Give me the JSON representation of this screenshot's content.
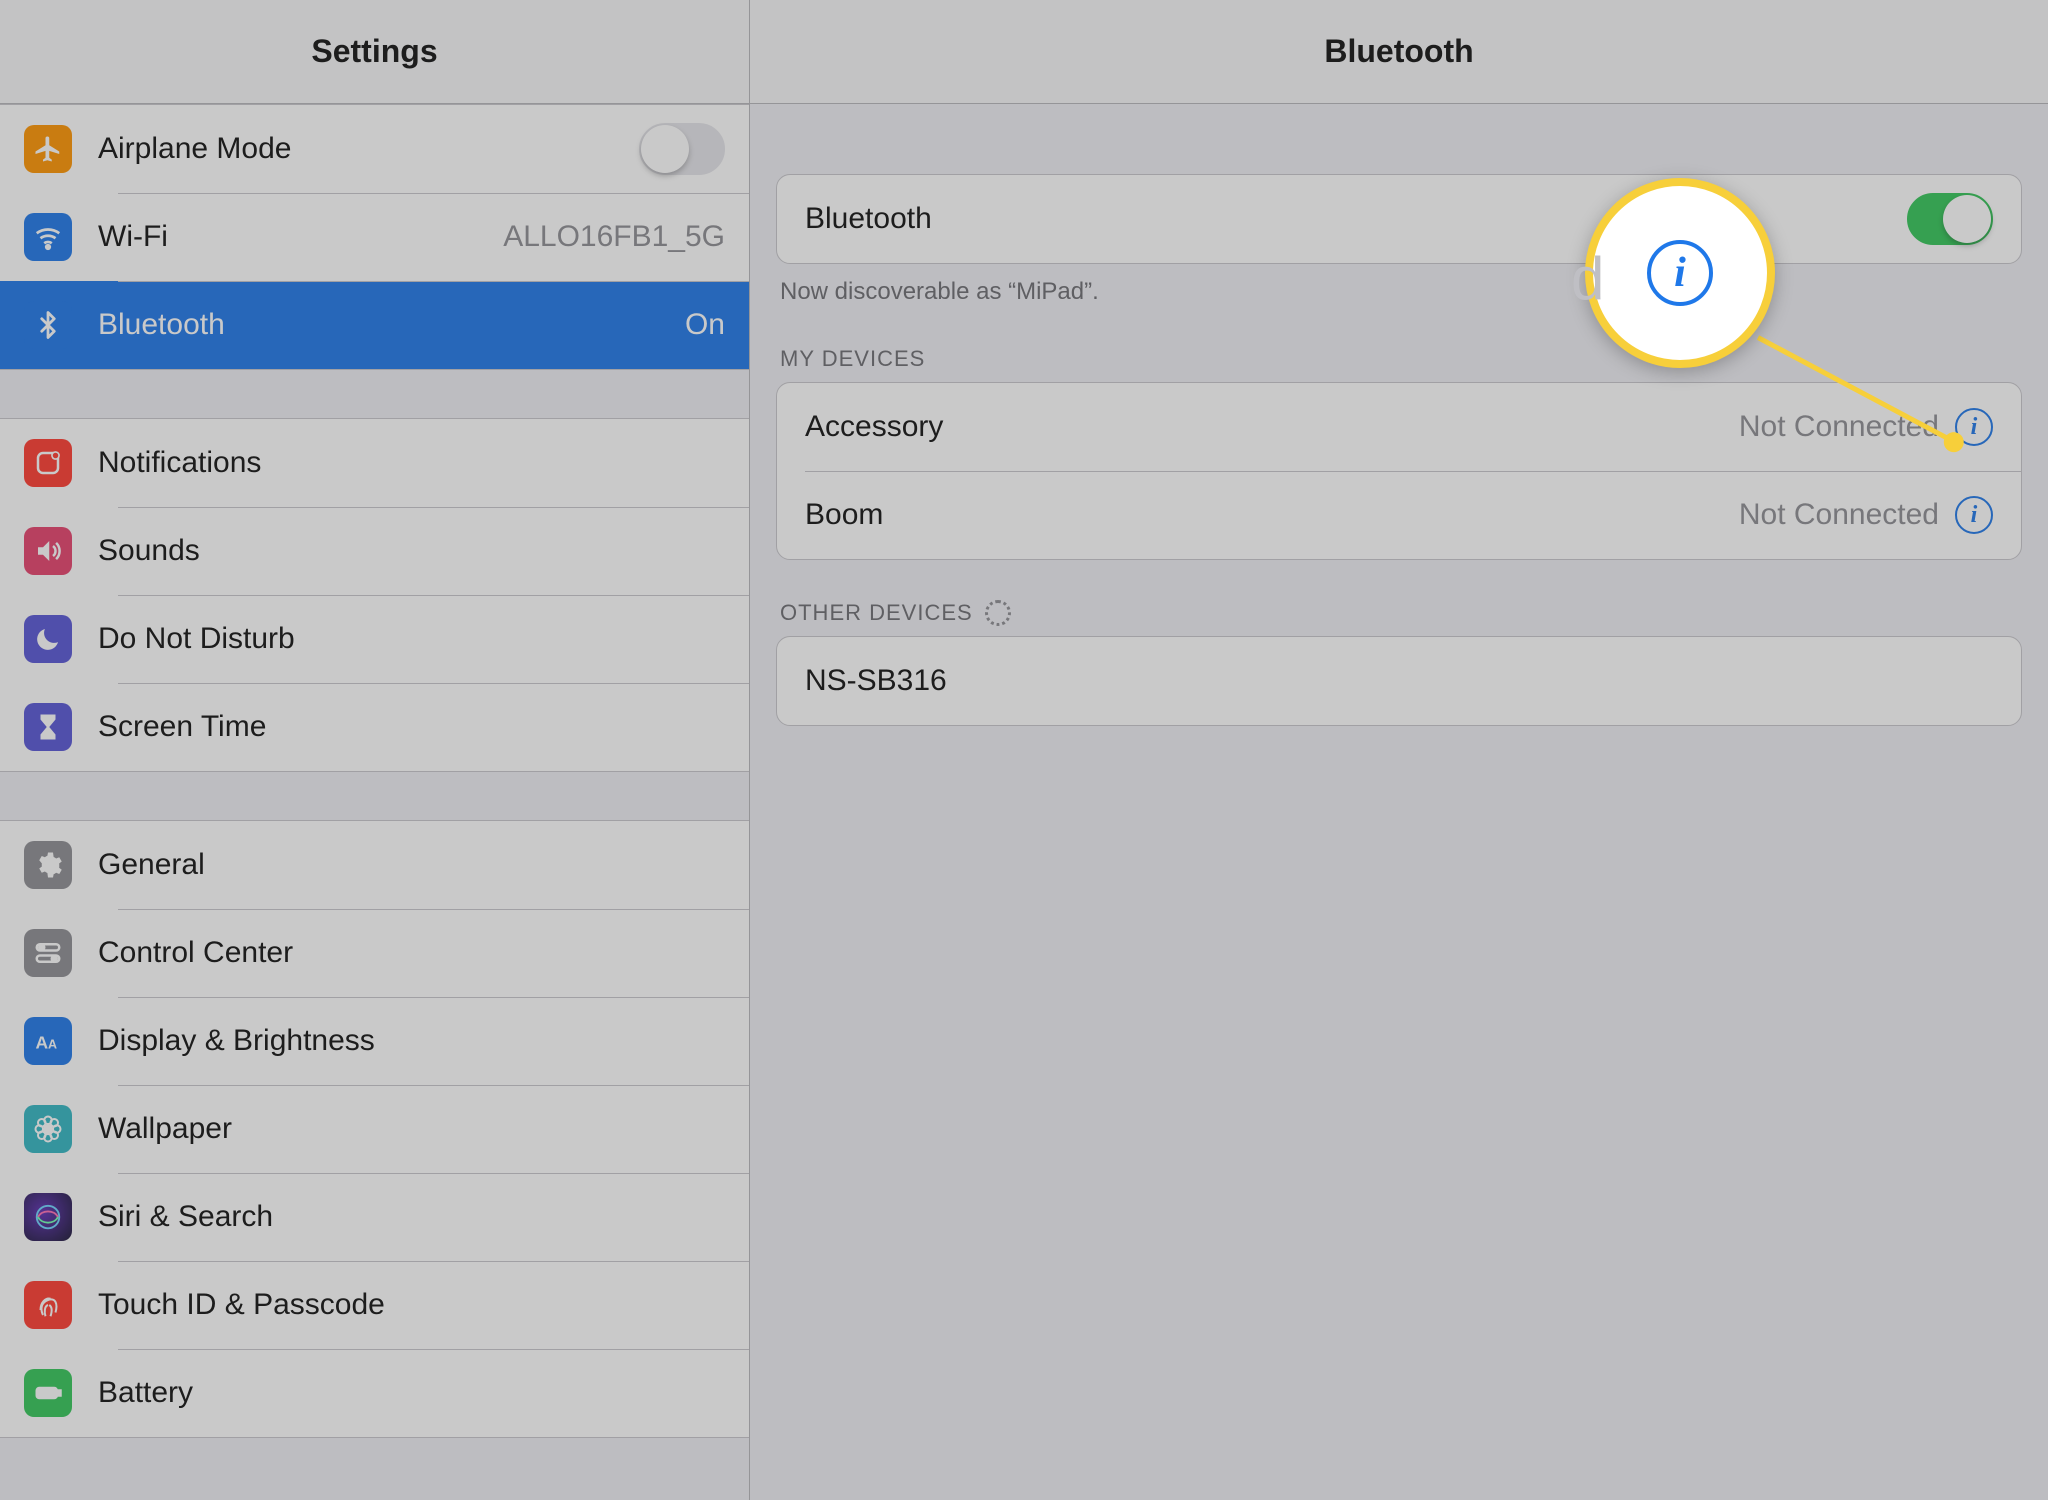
{
  "sidebar": {
    "title": "Settings",
    "groups": [
      {
        "items": [
          {
            "key": "airplane",
            "label": "Airplane Mode",
            "icon": "airplane-icon",
            "color": "orange",
            "accessory": "toggle",
            "toggle_on": false
          },
          {
            "key": "wifi",
            "label": "Wi-Fi",
            "icon": "wifi-icon",
            "color": "blue",
            "accessory": "value",
            "value": "ALLO16FB1_5G"
          },
          {
            "key": "bluetooth",
            "label": "Bluetooth",
            "icon": "bluetooth-icon",
            "color": "blue",
            "accessory": "value",
            "value": "On",
            "selected": true
          }
        ]
      },
      {
        "items": [
          {
            "key": "notifications",
            "label": "Notifications",
            "icon": "notifications-icon",
            "color": "red"
          },
          {
            "key": "sounds",
            "label": "Sounds",
            "icon": "sounds-icon",
            "color": "pink"
          },
          {
            "key": "dnd",
            "label": "Do Not Disturb",
            "icon": "moon-icon",
            "color": "purple"
          },
          {
            "key": "screentime",
            "label": "Screen Time",
            "icon": "hourglass-icon",
            "color": "purple"
          }
        ]
      },
      {
        "items": [
          {
            "key": "general",
            "label": "General",
            "icon": "gear-icon",
            "color": "grey"
          },
          {
            "key": "controlcenter",
            "label": "Control Center",
            "icon": "switches-icon",
            "color": "grey"
          },
          {
            "key": "display",
            "label": "Display & Brightness",
            "icon": "text-size-icon",
            "color": "blue"
          },
          {
            "key": "wallpaper",
            "label": "Wallpaper",
            "icon": "flower-icon",
            "color": "teal"
          },
          {
            "key": "siri",
            "label": "Siri & Search",
            "icon": "siri-icon",
            "color": "siri"
          },
          {
            "key": "touchid",
            "label": "Touch ID & Passcode",
            "icon": "fingerprint-icon",
            "color": "red"
          },
          {
            "key": "battery",
            "label": "Battery",
            "icon": "battery-icon",
            "color": "green"
          }
        ]
      }
    ]
  },
  "detail": {
    "title": "Bluetooth",
    "master_toggle": {
      "label": "Bluetooth",
      "on": true
    },
    "discoverable_text": "Now discoverable as “MiPad”.",
    "sections": [
      {
        "header": "MY DEVICES",
        "items": [
          {
            "name": "Accessory",
            "status": "Not Connected",
            "info": true
          },
          {
            "name": "Boom",
            "status": "Not Connected",
            "info": true
          }
        ]
      },
      {
        "header": "OTHER DEVICES",
        "spinner": true,
        "items": [
          {
            "name": "NS-SB316"
          }
        ]
      }
    ]
  },
  "annotation": {
    "hidden_text_under_callout": "d",
    "callout_points_to": "info-icon"
  }
}
